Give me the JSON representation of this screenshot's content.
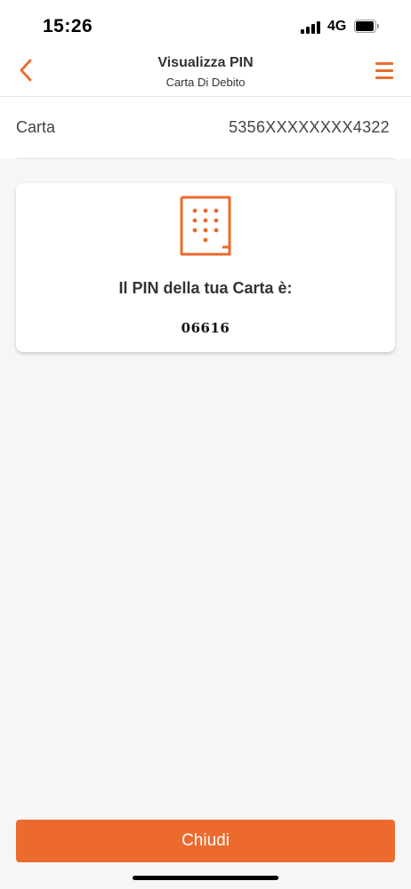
{
  "status_bar": {
    "time": "15:26",
    "network": "4G"
  },
  "nav": {
    "title": "Visualizza PIN",
    "subtitle": "Carta Di Debito",
    "back_icon": "chevron-left-icon",
    "menu_icon": "hamburger-menu-icon"
  },
  "card_row": {
    "label": "Carta",
    "number": "5356XXXXXXXX4322"
  },
  "pin_card": {
    "icon": "keypad-icon",
    "heading": "Il PIN della tua Carta è:",
    "value": "06616"
  },
  "footer": {
    "close_label": "Chiudi"
  },
  "colors": {
    "accent": "#ec6a2e",
    "background": "#f7f6f6",
    "surface": "#ffffff",
    "text": "#333333"
  }
}
